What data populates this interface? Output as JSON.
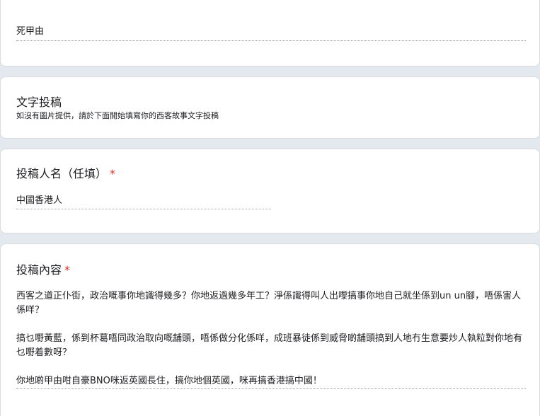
{
  "reason_question": {
    "answer": "死甲由"
  },
  "text_submission": {
    "title": "文字投稿",
    "description": "如沒有圖片提供，請於下面開始填寫你的西客故事文字投稿"
  },
  "name_question": {
    "title": "投稿人名（任填）",
    "required_mark": "*",
    "answer": "中國香港人"
  },
  "content_question": {
    "title": "投稿內容",
    "required_mark": "*",
    "paragraphs": [
      "西客之道正仆街，政治嘅事你地識得幾多？你地返過幾多年工？淨係識得叫人出嚟搞事你地自己就坐係到un un腳，唔係害人係咩？",
      "搞乜嘢黃藍，係到杯葛唔同政治取向嘅舖頭，唔係做分化係咩，成班暴徒係到威脅啲舖頭搞到人地冇生意要炒人執粒對你地有乜嘢着數呀？",
      "你地啲甲由咁自豪BNO咪返英國長住，搞你地個英國，咪再搞香港搞中國！"
    ]
  }
}
